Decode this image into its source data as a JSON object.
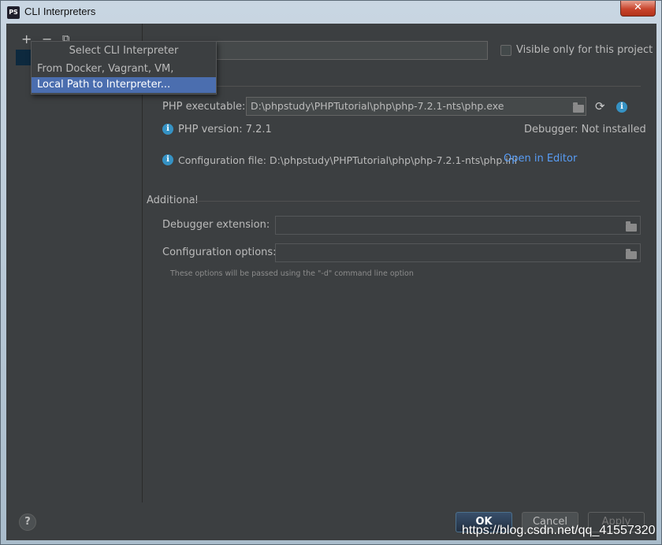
{
  "window": {
    "title": "CLI Interpreters",
    "app_icon_text": "PS",
    "close_glyph": "✕"
  },
  "toolbar": {
    "add": "+",
    "remove": "−",
    "copy": "⧉"
  },
  "popup": {
    "title": "Select CLI Interpreter",
    "items": [
      {
        "label": "From Docker, Vagrant, VM, Remote...",
        "active": false
      },
      {
        "label": "Local Path to Interpreter...",
        "active": true
      }
    ]
  },
  "visible_only": {
    "label": "Visible only for this project",
    "checked": false
  },
  "general": {
    "php_executable_label": "PHP executable:",
    "php_executable_value": "D:\\phpstudy\\PHPTutorial\\php\\php-7.2.1-nts\\php.exe",
    "php_version": "PHP version: 7.2.1",
    "debugger": "Debugger: Not installed",
    "config_file": "Configuration file: D:\\phpstudy\\PHPTutorial\\php\\php-7.2.1-nts\\php.ini",
    "open_in_editor": "Open in Editor"
  },
  "additional": {
    "section_title": "Additional",
    "debugger_extension_label": "Debugger extension:",
    "configuration_options_label": "Configuration options:",
    "hint": "These options will be passed using the \"-d\" command line option"
  },
  "footer": {
    "help": "?",
    "ok": "OK",
    "cancel": "Cancel",
    "apply": "Apply"
  },
  "watermark": "https://blog.csdn.net/qq_41557320",
  "colors": {
    "background": "#3c3f41",
    "selection": "#4b6eaf",
    "link": "#589df6",
    "info": "#3592c4"
  },
  "icons": [
    "app-icon",
    "close-icon",
    "add-icon",
    "remove-icon",
    "copy-icon",
    "folder-icon",
    "refresh-icon",
    "info-icon",
    "help-icon"
  ]
}
